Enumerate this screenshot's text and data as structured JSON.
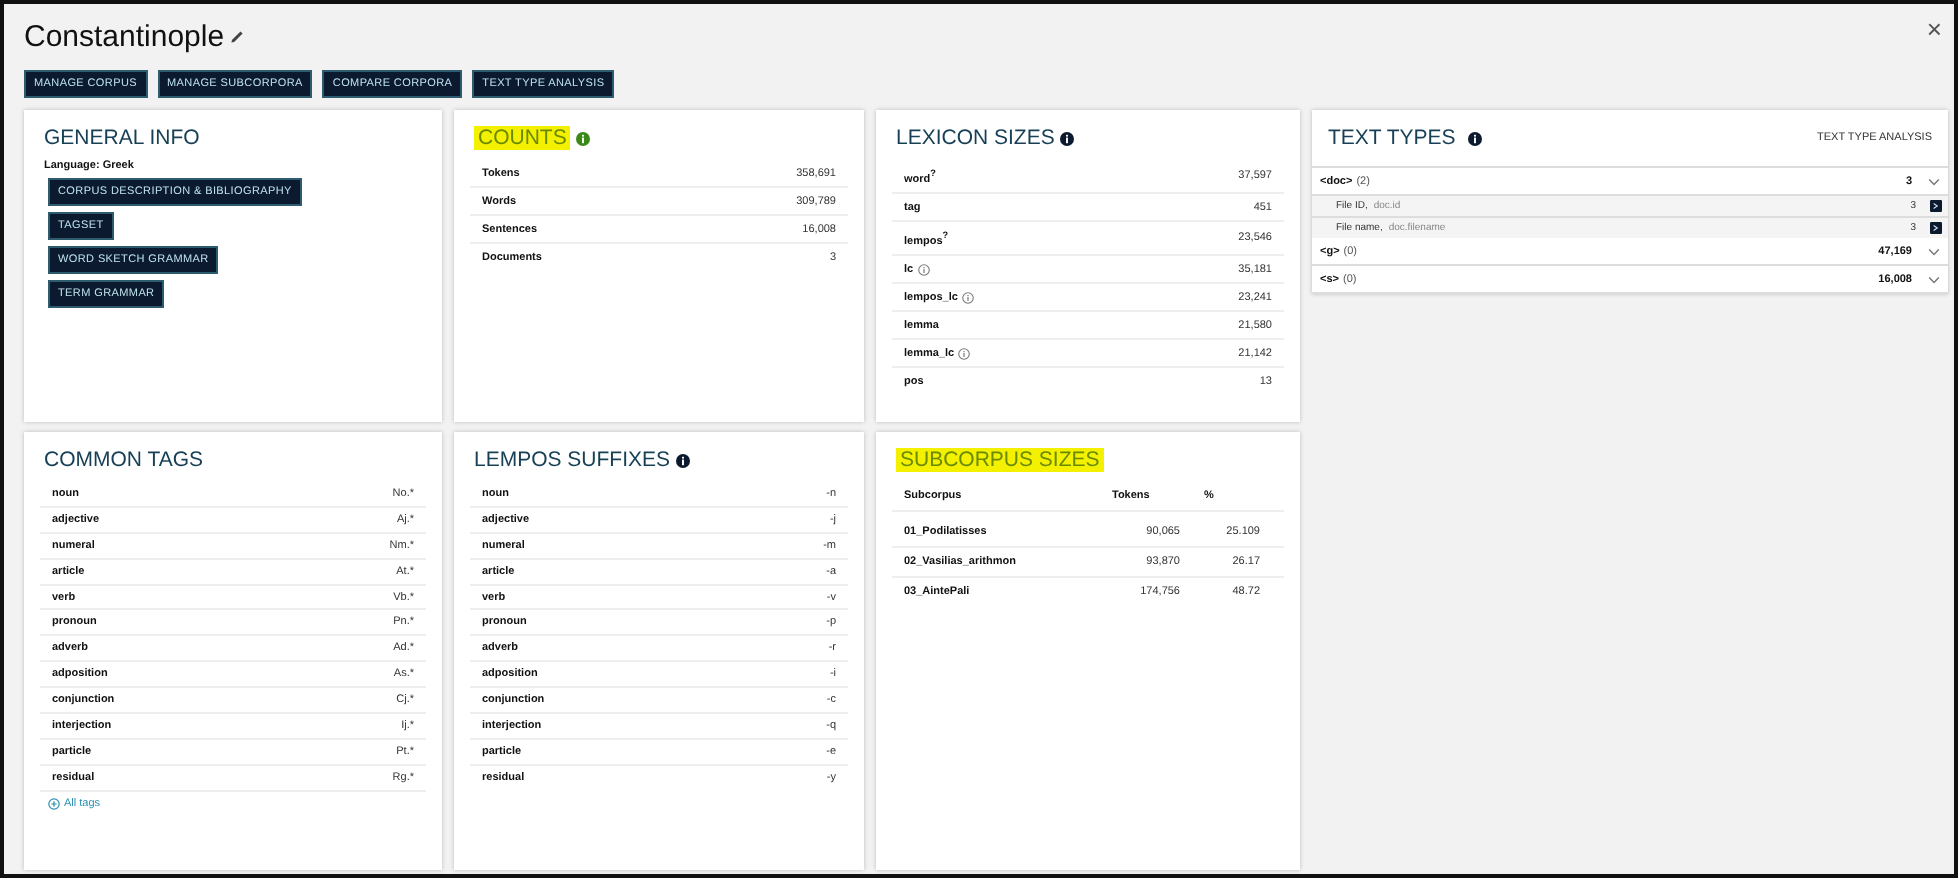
{
  "title": "Constantinople",
  "close": "×",
  "actions": [
    "MANAGE CORPUS",
    "MANAGE SUBCORPORA",
    "COMPARE CORPORA",
    "TEXT TYPE ANALYSIS"
  ],
  "general_info": {
    "title": "GENERAL INFO",
    "language": "Language: Greek",
    "buttons": [
      "CORPUS DESCRIPTION & BIBLIOGRAPHY",
      "TAGSET",
      "WORD SKETCH GRAMMAR",
      "TERM GRAMMAR"
    ]
  },
  "counts": {
    "title": "COUNTS",
    "highlighted": true,
    "rows": [
      {
        "label": "Tokens",
        "value": "358,691"
      },
      {
        "label": "Words",
        "value": "309,789"
      },
      {
        "label": "Sentences",
        "value": "16,008"
      },
      {
        "label": "Documents",
        "value": "3"
      }
    ]
  },
  "lexicon_sizes": {
    "title": "LEXICON SIZES",
    "highlighted": false,
    "rows": [
      {
        "label": "word$^{?}$",
        "value": "37,597",
        "info": false
      },
      {
        "label": "tag",
        "value": "451",
        "info": false
      },
      {
        "label": "lempos$^{?}$",
        "value": "23,546",
        "info": false
      },
      {
        "label": "lc",
        "value": "35,181",
        "info": true
      },
      {
        "label": "lempos_lc",
        "value": "23,241",
        "info": true
      },
      {
        "label": "lemma",
        "value": "21,580",
        "info": false
      },
      {
        "label": "lemma_lc",
        "value": "21,142",
        "info": true
      },
      {
        "label": "pos",
        "value": "13",
        "info": false
      }
    ]
  },
  "text_types": {
    "title": "TEXT TYPES",
    "link": "TEXT TYPE ANALYSIS",
    "rows": [
      {
        "kind": "group",
        "name": "<doc>",
        "count": "(2)",
        "value": "3"
      },
      {
        "kind": "attr",
        "name": "File ID,",
        "attr": "doc.id",
        "value": "3"
      },
      {
        "kind": "attr",
        "name": "File name,",
        "attr": "doc.filename",
        "value": "3"
      },
      {
        "kind": "group",
        "name": "<g>",
        "count": "(0)",
        "value": "47,169"
      },
      {
        "kind": "group",
        "name": "<s>",
        "count": "(0)",
        "value": "16,008"
      }
    ]
  },
  "common_tags": {
    "title": "COMMON TAGS",
    "highlighted": false,
    "rows": [
      {
        "label": "noun",
        "value": "No.*"
      },
      {
        "label": "adjective",
        "value": "Aj.*"
      },
      {
        "label": "numeral",
        "value": "Nm.*"
      },
      {
        "label": "article",
        "value": "At.*"
      },
      {
        "label": "verb",
        "value": "Vb.*"
      },
      {
        "label": "pronoun",
        "value": "Pn.*"
      },
      {
        "label": "adverb",
        "value": "Ad.*"
      },
      {
        "label": "adposition",
        "value": "As.*"
      },
      {
        "label": "conjunction",
        "value": "Cj.*"
      },
      {
        "label": "interjection",
        "value": "Ij.*"
      },
      {
        "label": "particle",
        "value": "Pt.*"
      },
      {
        "label": "residual",
        "value": "Rg.*"
      }
    ],
    "link": "All tags"
  },
  "lempos_suffixes": {
    "title": "LEMPOS SUFFIXES",
    "highlighted": false,
    "rows": [
      {
        "label": "noun",
        "value": "-n"
      },
      {
        "label": "adjective",
        "value": "-j"
      },
      {
        "label": "numeral",
        "value": "-m"
      },
      {
        "label": "article",
        "value": "-a"
      },
      {
        "label": "verb",
        "value": "-v"
      },
      {
        "label": "pronoun",
        "value": "-p"
      },
      {
        "label": "adverb",
        "value": "-r"
      },
      {
        "label": "adposition",
        "value": "-i"
      },
      {
        "label": "conjunction",
        "value": "-c"
      },
      {
        "label": "interjection",
        "value": "-q"
      },
      {
        "label": "particle",
        "value": "-e"
      },
      {
        "label": "residual",
        "value": "-y"
      }
    ]
  },
  "subcorpus_sizes": {
    "title": "SUBCORPUS SIZES",
    "highlighted": true,
    "columns": [
      "Subcorpus",
      "Tokens",
      "%"
    ],
    "rows": [
      [
        "01_Podilatisses",
        "90,065",
        "25.109"
      ],
      [
        "02_Vasilias_arithmon",
        "93,870",
        "26.17"
      ],
      [
        "03_AintePali",
        "174,756",
        "48.72"
      ]
    ]
  }
}
